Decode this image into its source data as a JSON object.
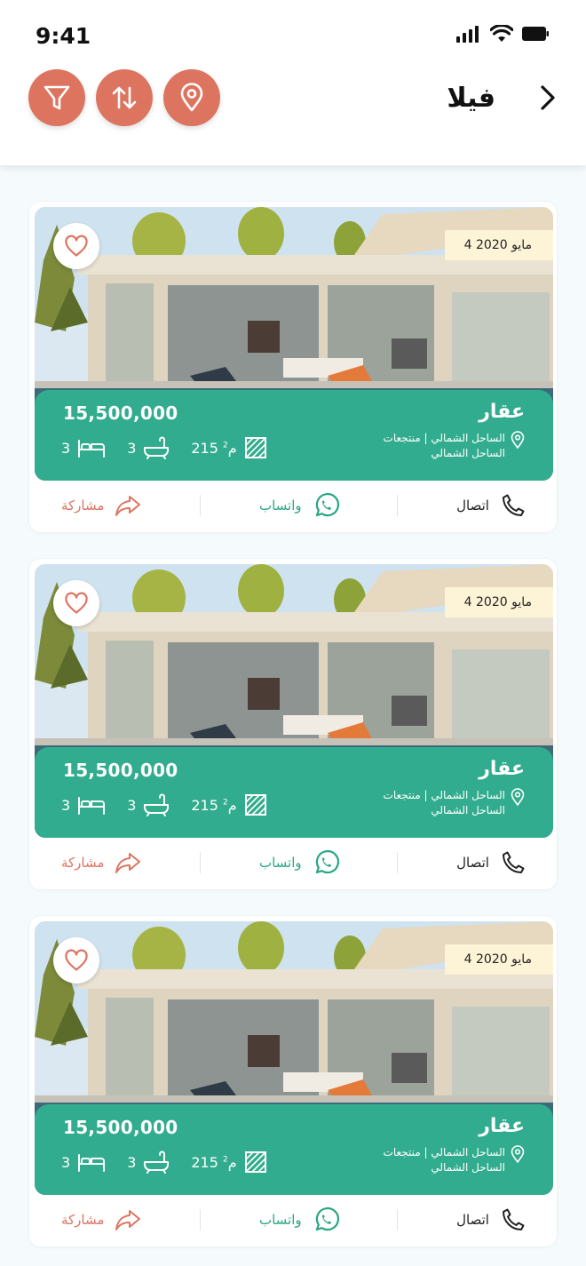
{
  "status_bar": {
    "time": "9:41"
  },
  "header": {
    "title": "فيلا"
  },
  "toolbar": {
    "filter_icon": "filter-icon",
    "sort_icon": "sort-icon",
    "location_icon": "location-pin-icon"
  },
  "colors": {
    "accent": "#dd7460",
    "panel": "#31b190",
    "badge": "#fdf3d6"
  },
  "listings": [
    {
      "date": "4 مايو 2020",
      "name": "عقار",
      "price": "15,500,000",
      "location": "الساحل الشمالي | منتجعات الساحل الشمالي",
      "area": "215",
      "area_unit": "م",
      "baths": "3",
      "beds": "3",
      "call_label": "اتصال",
      "whatsapp_label": "واتساب",
      "share_label": "مشاركة"
    },
    {
      "date": "4 مايو 2020",
      "name": "عقار",
      "price": "15,500,000",
      "location": "الساحل الشمالي | منتجعات الساحل الشمالي",
      "area": "215",
      "area_unit": "م",
      "baths": "3",
      "beds": "3",
      "call_label": "اتصال",
      "whatsapp_label": "واتساب",
      "share_label": "مشاركة"
    },
    {
      "date": "4 مايو 2020",
      "name": "عقار",
      "price": "15,500,000",
      "location": "الساحل الشمالي | منتجعات الساحل الشمالي",
      "area": "215",
      "area_unit": "م",
      "baths": "3",
      "beds": "3",
      "call_label": "اتصال",
      "whatsapp_label": "واتساب",
      "share_label": "مشاركة"
    }
  ]
}
